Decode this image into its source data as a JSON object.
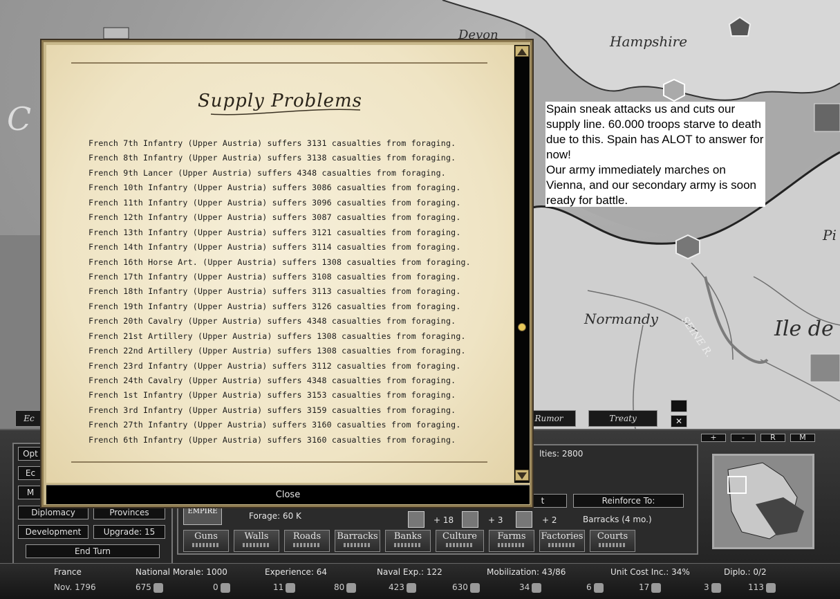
{
  "map": {
    "labels": {
      "devon": "Devon",
      "hampshire": "Hampshire",
      "normandy": "Normandy",
      "ile_de": "Ile de",
      "seine": "SEINE R.",
      "pi": "Pi",
      "c": "C"
    }
  },
  "note": {
    "paragraph1": "Spain sneak attacks us and cuts our supply line. 60.000 troops starve to death due to this. Spain has ALOT to answer for now!",
    "paragraph2": "Our army immediately marches on Vienna, and our secondary army is soon ready for battle."
  },
  "dialog": {
    "title": "Supply Problems",
    "close_label": "Close",
    "messages": [
      "French 7th Infantry  (Upper Austria)  suffers 3131 casualties from foraging.",
      "French 8th Infantry  (Upper Austria)  suffers 3138 casualties from foraging.",
      "French 9th Lancer  (Upper Austria)  suffers 4348 casualties from foraging.",
      "French 10th Infantry  (Upper Austria)  suffers 3086 casualties from foraging.",
      "French 11th Infantry  (Upper Austria)  suffers 3096 casualties from foraging.",
      "French 12th Infantry  (Upper Austria)  suffers 3087 casualties from foraging.",
      "French 13th Infantry  (Upper Austria)  suffers 3121 casualties from foraging.",
      "French 14th Infantry  (Upper Austria)  suffers 3114 casualties from foraging.",
      "French 16th Horse Art.  (Upper Austria)  suffers 1308 casualties from foraging.",
      "French 17th Infantry  (Upper Austria)  suffers 3108 casualties from foraging.",
      "French 18th Infantry  (Upper Austria)  suffers 3113 casualties from foraging.",
      "French 19th Infantry  (Upper Austria)  suffers 3126 casualties from foraging.",
      "French 20th Cavalry  (Upper Austria)  suffers 4348 casualties from foraging.",
      "French 21st Artillery  (Upper Austria)  suffers 1308 casualties from foraging.",
      "French 22nd Artillery  (Upper Austria)  suffers 1308 casualties from foraging.",
      "French 23rd Infantry  (Upper Austria)  suffers 3112 casualties from foraging.",
      "French 24th Cavalry  (Upper Austria)  suffers 4348 casualties from foraging.",
      "French 1st Infantry  (Upper Austria)  suffers 3153 casualties from foraging.",
      "French 3rd Infantry  (Upper Austria)  suffers 3159 casualties from foraging.",
      "French 27th Infantry  (Upper Austria)  suffers 3160 casualties from foraging.",
      "French 6th Infantry  (Upper Austria)  suffers 3160 casualties from foraging."
    ]
  },
  "tabs": {
    "left_partial": "Ec",
    "rumor": "Rumor",
    "treaty": "Treaty"
  },
  "map_controls": {
    "plus": "+",
    "minus": "-",
    "r": "R",
    "m": "M"
  },
  "left_menu": {
    "options": "Opt",
    "economy": "Ec",
    "m": "M",
    "diplomacy": "Diplomacy",
    "provinces": "Provinces",
    "development": "Development",
    "upgrade": "Upgrade: 15",
    "end_turn": "End Turn"
  },
  "province": {
    "casualties": "lties: 2800",
    "empire_badge": "EMPIRE",
    "forage": "Forage: 60 K",
    "bonus1": "+ 18",
    "bonus2": "+ 3",
    "bonus3": "+ 2",
    "barracks": "Barracks (4 mo.)",
    "reinforce": "Reinforce To:",
    "partial_btn": "t"
  },
  "build_buttons": [
    "Guns",
    "Walls",
    "Roads",
    "Barracks",
    "Banks",
    "Culture",
    "Farms",
    "Factories",
    "Courts"
  ],
  "status": {
    "nation": "France",
    "date": "Nov. 1796",
    "national_morale": "National Morale: 1000",
    "experience": "Experience: 64",
    "naval_exp": "Naval Exp.: 122",
    "mobilization": "Mobilization: 43/86",
    "unit_cost": "Unit Cost Inc.: 34%",
    "diplo": "Diplo.: 0/2"
  },
  "resources": [
    {
      "value": "675",
      "icon": "supplies-icon"
    },
    {
      "value": "0",
      "icon": "tools-icon"
    },
    {
      "value": "11",
      "icon": "horse-icon"
    },
    {
      "value": "80",
      "icon": "uniform-icon"
    },
    {
      "value": "423",
      "icon": "musket-icon"
    },
    {
      "value": "630",
      "icon": "cannon-icon"
    },
    {
      "value": "34",
      "icon": "barrel-icon"
    },
    {
      "value": "6",
      "icon": "bottle-icon"
    },
    {
      "value": "17",
      "icon": "sword-icon"
    },
    {
      "value": "3",
      "icon": "armor-icon"
    },
    {
      "value": "113",
      "icon": "ammo-icon"
    }
  ]
}
